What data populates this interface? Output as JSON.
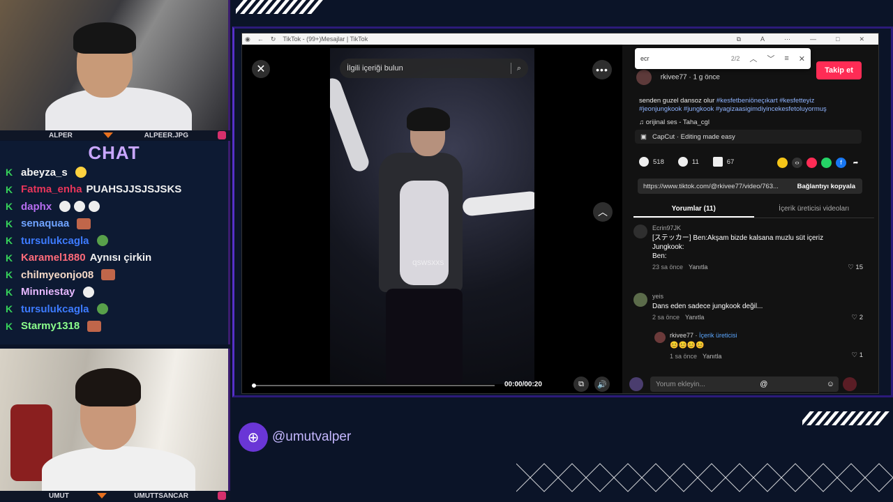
{
  "overlay": {
    "top_cam_label_left": "ALPER",
    "top_cam_label_right": "ALPEER.JPG",
    "bottom_cam_label_left": "UMUT",
    "bottom_cam_label_right": "UMUTTSANCAR",
    "chat_title": "CHAT",
    "social_handle": "@umutvalper"
  },
  "chat": [
    {
      "user": "abeyza_s",
      "color": "#f5f5f5",
      "msg": ""
    },
    {
      "user": "Fatma_enha",
      "color": "#e8355a",
      "msg": "PUAHSJJSJSJSKS"
    },
    {
      "user": "daphx",
      "color": "#b66df0",
      "msg": ""
    },
    {
      "user": "senaquaa",
      "color": "#6fa3ff",
      "msg": ""
    },
    {
      "user": "tursulukcagla",
      "color": "#3d7bff",
      "msg": ""
    },
    {
      "user": "Karamel1880",
      "color": "#ff6b7a",
      "msg": "Aynısı çirkin"
    },
    {
      "user": "chilmyeonjo08",
      "color": "#f5d9c7",
      "msg": ""
    },
    {
      "user": "Minniestay",
      "color": "#e6b8ff",
      "msg": ""
    },
    {
      "user": "tursulukcagla",
      "color": "#3d7bff",
      "msg": ""
    },
    {
      "user": "Starmy1318",
      "color": "#8cff8c",
      "msg": ""
    }
  ],
  "browser": {
    "tab_title": "TikTok - (99+)Mesajlar | TikTok"
  },
  "video": {
    "search_placeholder": "İlgili içeriği bulun",
    "watermark": "qswsxxs",
    "time": "00:00/00:20",
    "progress": 0
  },
  "find": {
    "query": "ecr",
    "count": "2/2"
  },
  "post": {
    "author": "rkivee77 · 1 g önce",
    "follow_label": "Takip et",
    "desc_text": "senden guzel dansoz olur ",
    "desc_tags_1": "#kesfetbeniönеçıkart #kesfetteyiz",
    "desc_tags_2": "#jeonjungkook #jungkook #yagizaasigimdiyincekesfetoluyormuş",
    "music": "♫  orijinal ses - Taha_cgl",
    "capcut": "CapCut · Editing made easy",
    "likes": "518",
    "comments_count": "11",
    "saves": "67",
    "link": "https://www.tiktok.com/@rkivee77/video/763...",
    "copy_label": "Bağlantıyı kopyala",
    "tab_comments": "Yorumlar (11)",
    "tab_creator": "İçerik üreticisi videoları",
    "input_placeholder": "Yorum ekleyin..."
  },
  "comments": [
    {
      "name": "Ecrin97JK",
      "text1": "[ステッカー] Ben:Akşam bizde kalsana muzlu süt içeriz",
      "text2": "Jungkook:",
      "text3": "Ben:",
      "time": "23 sa önce",
      "reply": "Yanıtla",
      "likes": "15"
    },
    {
      "name": "yeis",
      "text1": "Dans eden sadece jungkook değil...",
      "time": "2 sa önce",
      "reply": "Yanıtla",
      "likes": "2"
    },
    {
      "name": "rkivee77",
      "creator": "İçerik üreticisi",
      "text1": "😊😊😊😊",
      "time": "1 sa önce",
      "reply": "Yanıtla",
      "likes": "1"
    }
  ]
}
